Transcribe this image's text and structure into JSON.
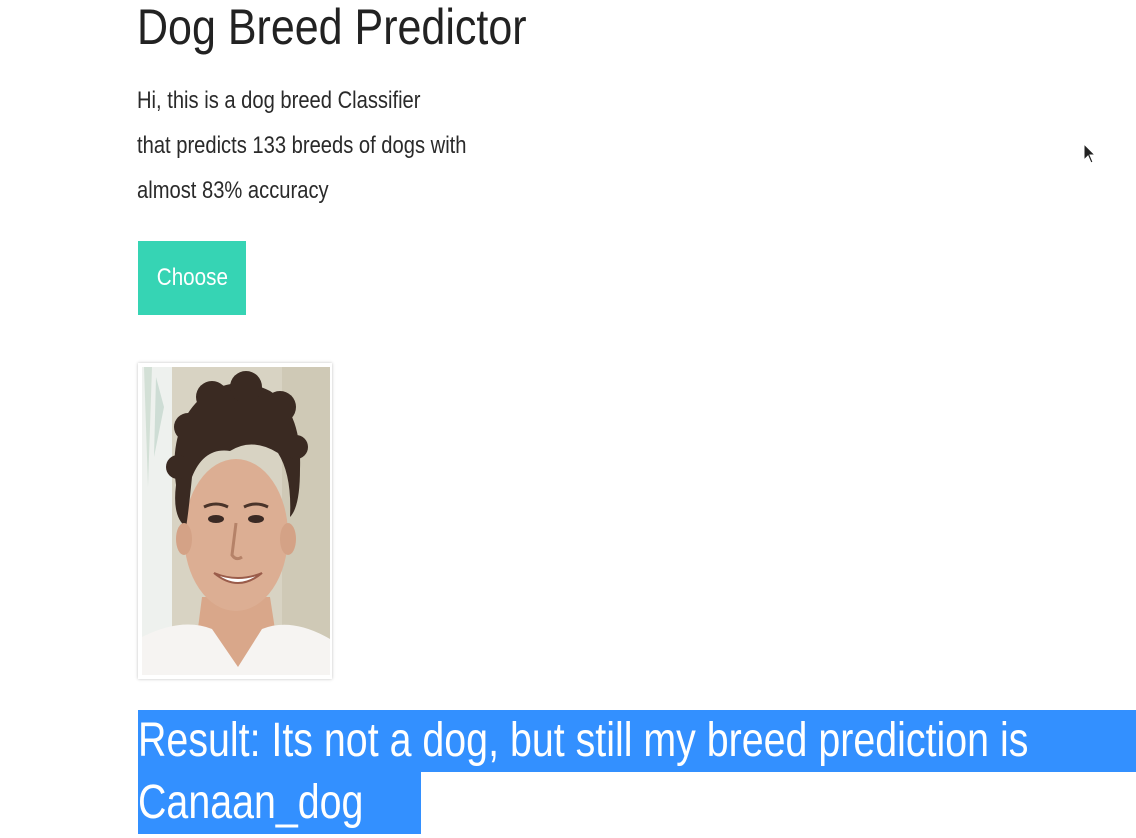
{
  "header": {
    "title": "Dog Breed Predictor"
  },
  "intro": {
    "lines": [
      "Hi, this is a dog breed Classifier",
      "that predicts 133 breeds of dogs with",
      "almost 83% accuracy"
    ]
  },
  "upload": {
    "choose_label": "Choose"
  },
  "result": {
    "line1": "Result: Its not a dog, but still my breed prediction is",
    "line2": "Canaan_dog"
  },
  "colors": {
    "button": "#36d4b4",
    "selection_highlight": "#3390ff",
    "text": "#222222"
  }
}
